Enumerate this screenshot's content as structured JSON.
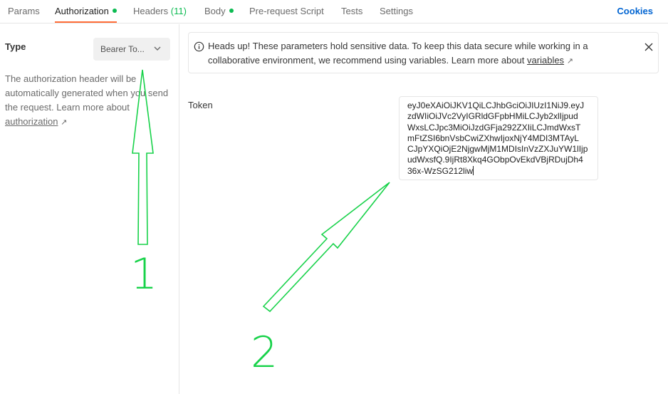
{
  "tabs": [
    {
      "label": "Params"
    },
    {
      "label": "Authorization"
    },
    {
      "label": "Headers"
    },
    {
      "label": "Body"
    },
    {
      "label": "Pre-request Script"
    },
    {
      "label": "Tests"
    },
    {
      "label": "Settings"
    }
  ],
  "headers_count": "(11)",
  "cookies_label": "Cookies",
  "left": {
    "type_label": "Type",
    "type_value": "Bearer To...",
    "help_text": "The authorization header will be automatically generated when you send the request. Learn more about",
    "help_link": "authorization",
    "ext_arrow": "↗"
  },
  "banner": {
    "text": "Heads up! These parameters hold sensitive data. To keep this data secure while working in a collaborative environment, we recommend using variables. Learn more about",
    "link": "variables",
    "ext_arrow": "↗"
  },
  "token": {
    "label": "Token",
    "lines": [
      "eyJ0eXAiOiJKV1QiLCJhbGciOiJIUzI1NiJ9.eyJ",
      "zdWIiOiJVc2VyIGRldGFpbHMiLCJyb2xlIjpud",
      "WxsLCJpc3MiOiJzdGFja292ZXIiLCJmdWxsT",
      "mFtZSI6bnVsbCwiZXhwIjoxNjY4MDI3MTAyL",
      "CJpYXQiOjE2NjgwMjM1MDIsInVzZXJuYW1lIjp",
      "udWxsfQ.9IjRt8Xkq4GObpOvEkdVBjRDujDh4",
      "36x-WzSG212liw"
    ]
  },
  "annotations": {
    "label_1": "1",
    "label_2": "2",
    "color": "#18d24a"
  },
  "colors": {
    "accent": "#ff6c37",
    "status_green": "#0cbb52",
    "link_blue": "#0265d2"
  }
}
